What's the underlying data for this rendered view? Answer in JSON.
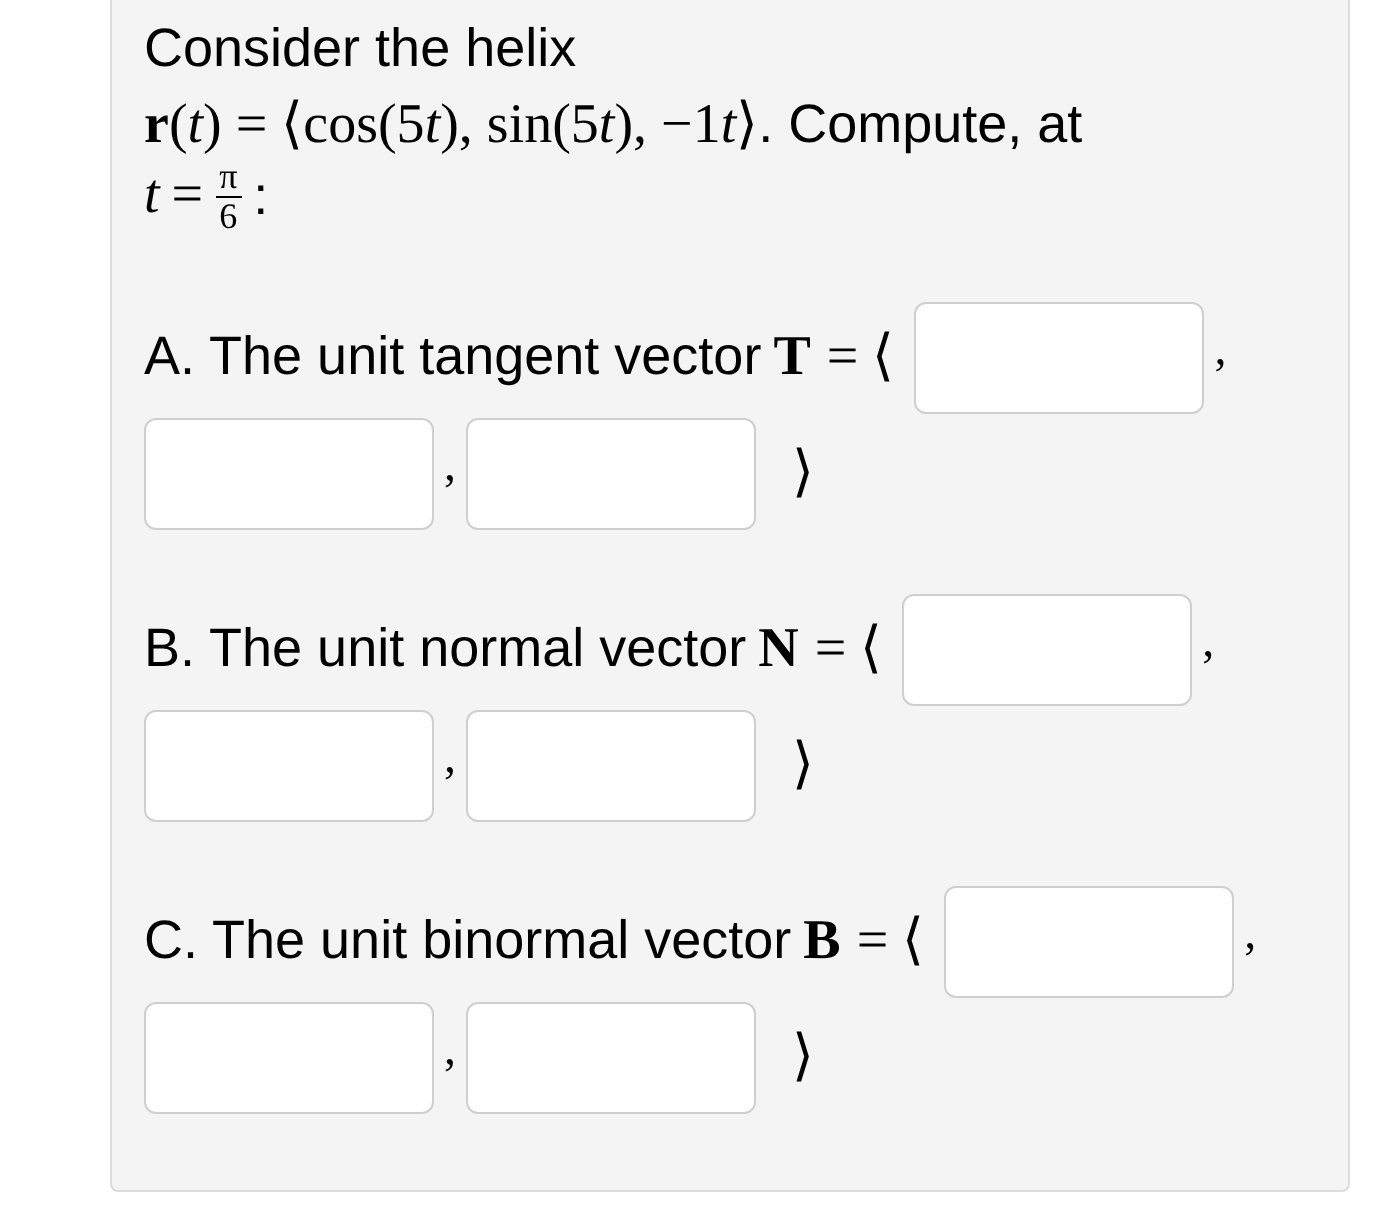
{
  "intro": "Consider the helix",
  "formula": [
    {
      "kind": "bold",
      "text": "r"
    },
    {
      "kind": "plain",
      "text": "("
    },
    {
      "kind": "italic",
      "text": "t"
    },
    {
      "kind": "plain",
      "text": ") = ⟨cos(5"
    },
    {
      "kind": "italic",
      "text": "t"
    },
    {
      "kind": "plain",
      "text": "), sin(5"
    },
    {
      "kind": "italic",
      "text": "t"
    },
    {
      "kind": "plain",
      "text": "), −1"
    },
    {
      "kind": "italic",
      "text": "t"
    },
    {
      "kind": "plain",
      "text": "⟩"
    }
  ],
  "formula_tail": ". Compute, at",
  "point": {
    "variable": "t",
    "equals": "=",
    "numerator": "π",
    "denominator": "6",
    "colon": ":"
  },
  "parts": [
    {
      "label": "A. The unit tangent vector",
      "symbol": "T",
      "open": "= ⟨",
      "separators": [
        ",",
        ","
      ],
      "close": "⟩"
    },
    {
      "label": "B. The unit normal vector",
      "symbol": "N",
      "open": "= ⟨",
      "separators": [
        ",",
        ","
      ],
      "close": "⟩"
    },
    {
      "label": "C. The unit binormal vector",
      "symbol": "B",
      "open": "= ⟨",
      "separators": [
        ",",
        ","
      ],
      "close": "⟩"
    }
  ]
}
